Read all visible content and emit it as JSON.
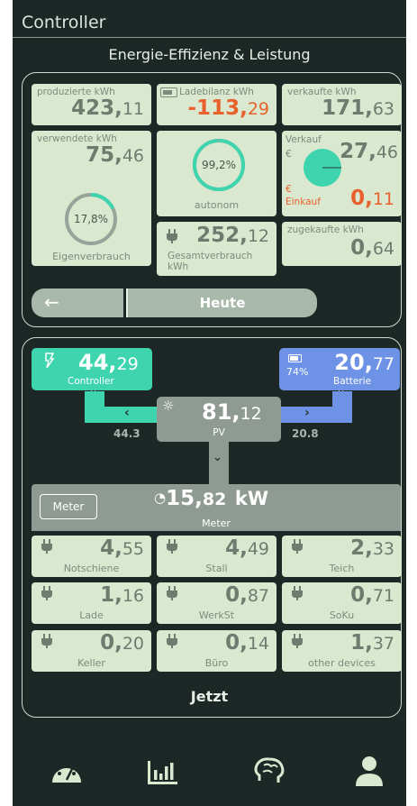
{
  "header": {
    "title": "Controller",
    "subtitle": "Energie-Effizienz & Leistung"
  },
  "stats": {
    "produced": {
      "label": "produzierte kWh",
      "int": "423,",
      "dec": "11"
    },
    "balance": {
      "label": "Ladebilanz kWh",
      "int": "-113,",
      "dec": "29"
    },
    "sold": {
      "label": "verkaufte kWh",
      "int": "171,",
      "dec": "63"
    },
    "used": {
      "label": "verwendete kWh",
      "int": "75,",
      "dec": "46",
      "gauge_text": "17,8%",
      "gauge_fraction": 0.178,
      "caption": "Eigenverbrauch"
    },
    "autonomy": {
      "gauge_text": "99,2%",
      "gauge_fraction": 0.992,
      "caption": "autonom"
    },
    "sale": {
      "verkauf_label": "Verkauf",
      "verkauf_currency": "€",
      "verkauf_int": "27,",
      "verkauf_dec": "46",
      "einkauf_currency": "€",
      "einkauf_label": "Einkauf",
      "einkauf_int": "0,",
      "einkauf_dec": "11"
    },
    "total": {
      "label": "Gesamtverbrauch kWh",
      "int": "252,",
      "dec": "12"
    },
    "bought": {
      "label": "zugekaufte kWh",
      "int": "0,",
      "dec": "64"
    }
  },
  "nav": {
    "back_label": "←",
    "period_label": "Heute"
  },
  "flow": {
    "controller": {
      "int": "44,",
      "dec": "29",
      "label": "Controller"
    },
    "battery": {
      "percent": "74%",
      "int": "20,",
      "dec": "77",
      "label": "Batterie"
    },
    "pv": {
      "int": "81,",
      "dec": "12",
      "label": "PV"
    },
    "left_value": "44.3",
    "right_value": "20.8",
    "meter": {
      "button": "Meter",
      "int": "15,",
      "dec": "82",
      "unit": "kW",
      "label": "Meter"
    }
  },
  "devices": [
    {
      "int": "4,",
      "dec": "55",
      "label": "Notschiene"
    },
    {
      "int": "4,",
      "dec": "49",
      "label": "Stall"
    },
    {
      "int": "2,",
      "dec": "33",
      "label": "Teich"
    },
    {
      "int": "1,",
      "dec": "16",
      "label": "Lade"
    },
    {
      "int": "0,",
      "dec": "87",
      "label": "WerkSt"
    },
    {
      "int": "0,",
      "dec": "71",
      "label": "SoKu"
    },
    {
      "int": "0,",
      "dec": "20",
      "label": "Keller"
    },
    {
      "int": "0,",
      "dec": "14",
      "label": "Büro"
    },
    {
      "int": "1,",
      "dec": "37",
      "label": "other devices"
    }
  ],
  "now_label": "Jetzt",
  "colors": {
    "bg": "#1d2826",
    "tile": "#dbe8d0",
    "controller": "#3ed4ae",
    "battery": "#6e93e6",
    "pv": "#8f9b92",
    "negative": "#e8602c"
  },
  "footer": {
    "icons": [
      "speedometer-icon",
      "bar-chart-icon",
      "brain-icon",
      "user-icon"
    ]
  }
}
